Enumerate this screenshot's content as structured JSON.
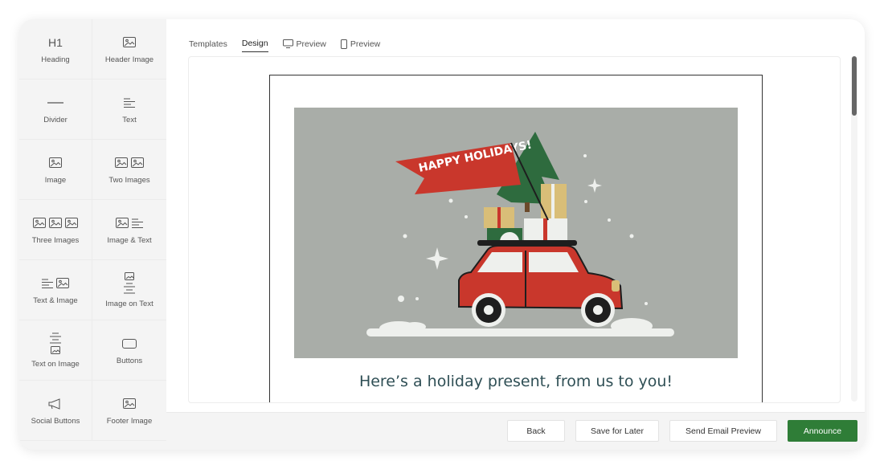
{
  "sidebar": {
    "blocks": [
      {
        "label": "Heading",
        "icon": "h1-icon",
        "icon_text": "H1"
      },
      {
        "label": "Header Image",
        "icon": "image-icon"
      },
      {
        "label": "Divider",
        "icon": "divider-icon"
      },
      {
        "label": "Text",
        "icon": "text-lines-icon"
      },
      {
        "label": "Image",
        "icon": "image-icon"
      },
      {
        "label": "Two Images",
        "icon": "two-images-icon"
      },
      {
        "label": "Three Images",
        "icon": "three-images-icon"
      },
      {
        "label": "Image & Text",
        "icon": "image-text-icon"
      },
      {
        "label": "Text & Image",
        "icon": "text-image-icon"
      },
      {
        "label": "Image on Text",
        "icon": "image-on-text-icon"
      },
      {
        "label": "Text on Image",
        "icon": "text-on-image-icon"
      },
      {
        "label": "Buttons",
        "icon": "button-icon"
      },
      {
        "label": "Social Buttons",
        "icon": "megaphone-icon"
      },
      {
        "label": "Footer Image",
        "icon": "image-icon"
      }
    ]
  },
  "tabs": [
    {
      "label": "Templates",
      "active": false
    },
    {
      "label": "Design",
      "active": true
    },
    {
      "label": "Preview",
      "icon": "desktop-icon"
    },
    {
      "label": "Preview",
      "icon": "mobile-icon"
    }
  ],
  "email": {
    "banner_text": "HAPPY HOLIDAYS!",
    "headline": "Here’s a holiday present, from us to you!"
  },
  "footer": {
    "back": "Back",
    "save": "Save for Later",
    "preview": "Send Email Preview",
    "announce": "Announce"
  },
  "colors": {
    "hero_bg": "#a9ada8",
    "car_red": "#c9372c",
    "banner_red": "#c9372c",
    "tree_green": "#2e6b3e",
    "announce_green": "#2f7d37",
    "headline": "#2f4f55"
  }
}
